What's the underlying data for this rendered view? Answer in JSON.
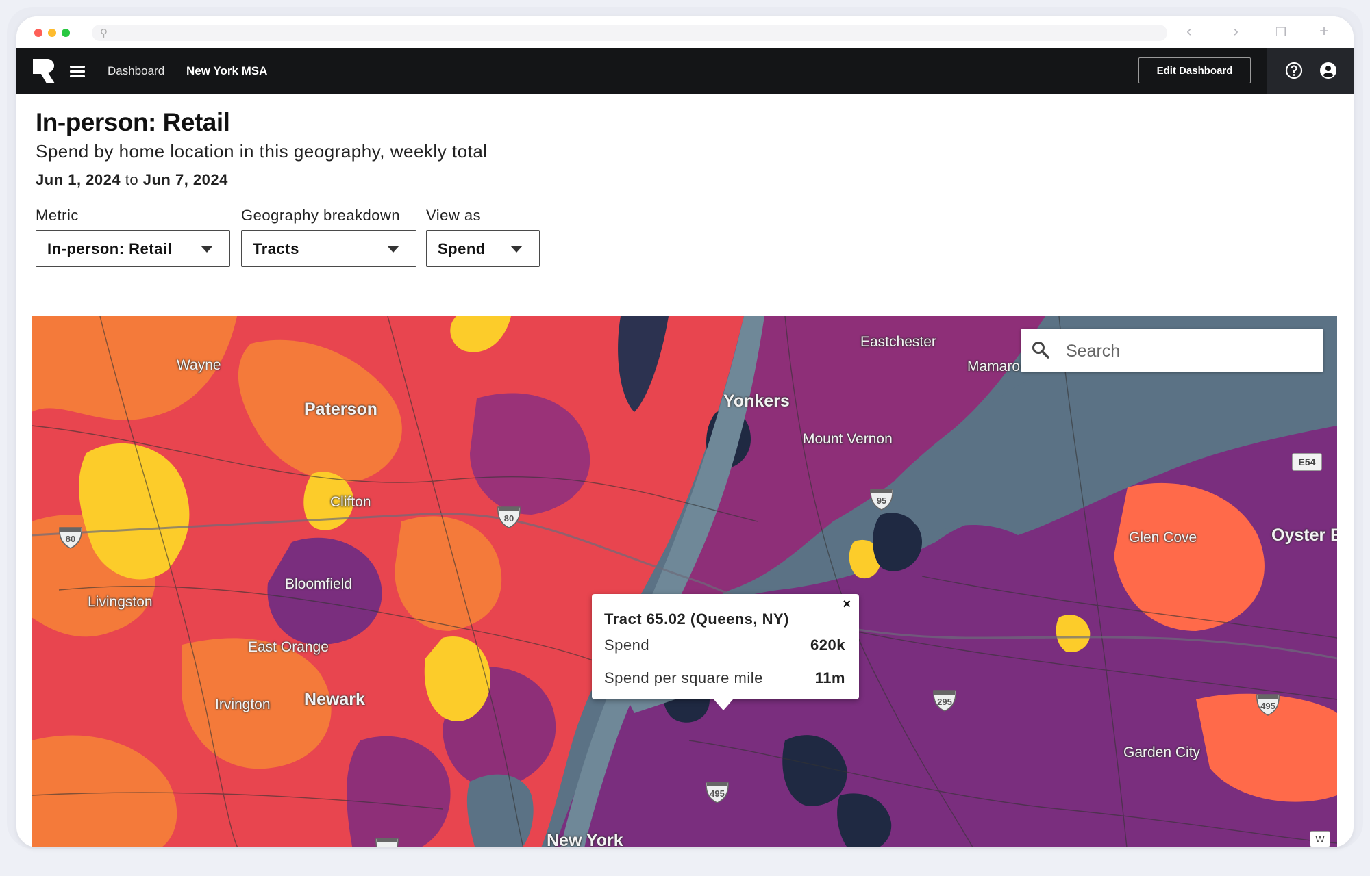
{
  "app": {
    "breadcrumb": [
      "Dashboard",
      "New York MSA"
    ],
    "edit_button": "Edit Dashboard",
    "icons": [
      "menu-icon",
      "help-icon",
      "user-icon"
    ]
  },
  "header": {
    "title": "In-person: Retail",
    "subtitle": "Spend by home location in this geography, weekly total",
    "date_start": "Jun 1, 2024",
    "date_to": "to",
    "date_end": "Jun 7, 2024"
  },
  "filters": {
    "metric": {
      "label": "Metric",
      "value": "In-person: Retail"
    },
    "geography": {
      "label": "Geography breakdown",
      "value": "Tracts"
    },
    "view_as": {
      "label": "View as",
      "value": "Spend"
    }
  },
  "map": {
    "search_placeholder": "Search",
    "places": {
      "wayne": "Wayne",
      "paterson": "Paterson",
      "clifton": "Clifton",
      "bloomfield": "Bloomfield",
      "livingston": "Livingston",
      "east_orange": "East Orange",
      "newark": "Newark",
      "irvington": "Irvington",
      "yonkers": "Yonkers",
      "mount_vernon": "Mount Vernon",
      "eastchester": "Eastchester",
      "mamaroneck": "Mamaro",
      "glen_cove": "Glen Cove",
      "oyster_bay": "Oyster E",
      "garden_city": "Garden City",
      "new_york": "New York"
    },
    "shields": {
      "i80a": "80",
      "i80b": "80",
      "i95a": "95",
      "i95b": "95",
      "i295": "295",
      "i495a": "495",
      "i495b": "495"
    },
    "e54": "E54",
    "w_badge": "W",
    "colors": {
      "water": "#5b7285",
      "low": "#1f2942",
      "mid": "#7a2e7e",
      "high": "#e8454f",
      "top": "#fccc2a"
    }
  },
  "tooltip": {
    "close": "×",
    "title": "Tract 65.02 (Queens, NY)",
    "rows": [
      {
        "label": "Spend",
        "value": "620k"
      },
      {
        "label": "Spend per square mile",
        "value": "11m"
      }
    ]
  }
}
